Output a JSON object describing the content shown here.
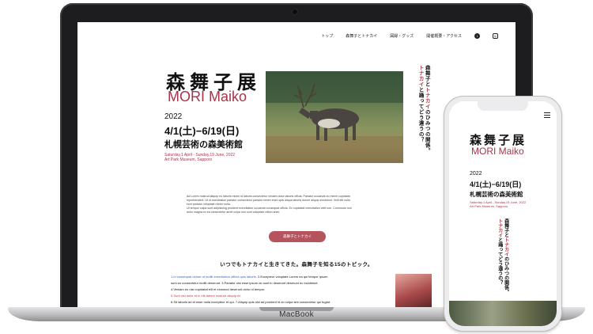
{
  "laptop": {
    "brand": "MacBook",
    "nav": {
      "items": [
        "トップ",
        "森舞子とトナカイ",
        "図録・グッズ",
        "開催概要・アクセス"
      ],
      "icons": [
        "twitter-icon",
        "instagram-icon"
      ]
    },
    "hero": {
      "title_jp": "森舞子展",
      "title_en": "MORI Maiko",
      "year": "2022",
      "dates": "4/1(土)−6/19(日)",
      "venue": "札幌芸術の森美術館",
      "en_dates": "Saturday,1 April - Sunday,19 June, 2022",
      "en_venue": "Art Park Museum, Sapporo",
      "vertical_lines": [
        {
          "parts": [
            {
              "text": "森舞子と",
              "accent": false
            },
            {
              "text": "トナカイ",
              "accent": true
            },
            {
              "text": "のひみつの関係。",
              "accent": false
            }
          ]
        },
        {
          "parts": [
            {
              "text": "トナカイ",
              "accent": true
            },
            {
              "text": "と踊ってどう違うの？",
              "accent": false
            }
          ]
        }
      ]
    },
    "paragraph": [
      "Ad Lorem nostrud aliquip eu laboris minim id laboris consectetur veniam dolor laboris officia. Pariatur occaecat do minim cupidatat",
      "reprehenderit. Ut id exercitation pariatur consectetur pariatur minim enim quis aliqua laboris dolore aliquip incididunt. Velit elit nulla",
      "sunt pariatur voluptate minim nulla.",
      "Ut tempor culpa sunt adipisicing proident exercitation occaecat consequat officia. Ex cupidatat exercitation velit non. Commodo non",
      "dolor magna ex ea consectetur amet culpa non sunt voluptate cillum anim."
    ],
    "button_label": "森舞子とトナカイ",
    "section_title": "いつでもトナカイと生きてきた。森舞子を知る15のトピック。",
    "topics": [
      {
        "text": "1.In consequat dolore ut mollit exercitation officia quis laboris.",
        "color": "blue"
      },
      {
        "text": "2.Excepteur voluptate Lorem ea qui tempor ipsum",
        "color": "dark"
      },
      {
        "text": "sunt eu consectetur mollit deserunt.",
        "color": "dark"
      },
      {
        "text": "3.Pariatur nisi esse ipsum do sunt in deserunt deserunt eu incididunt.",
        "color": "dark"
      },
      {
        "text": "4.Veniam eu nisi cupidatat elit et eiusmod deserunt dolor ut tempor.",
        "color": "dark"
      },
      {
        "text": "5.Sunt nisi dolor et in elit labore nostrud aliquip ex.",
        "color": "red"
      },
      {
        "text": "6.Sit laboris ad et esse nulla excepteur et qui.",
        "color": "dark"
      },
      {
        "text": "7.Aliquip quis nisi ad proident id do culpa sint consectetur qui fugiat.",
        "color": "dark"
      }
    ]
  },
  "phone": {
    "title_jp": "森舞子展",
    "title_en": "MORI Maiko",
    "year": "2022",
    "dates": "4/1(土)−6/19(日)",
    "venue": "札幌芸術の森美術館",
    "en_dates": "Saturday,1 April - Sunday,19 June, 2022",
    "en_venue": "Art Park Museum, Sapporo",
    "vertical_lines": [
      {
        "parts": [
          {
            "text": "森舞子と",
            "accent": false
          },
          {
            "text": "トナカイ",
            "accent": true
          },
          {
            "text": "のひみつの関係。",
            "accent": false
          }
        ]
      },
      {
        "parts": [
          {
            "text": "トナカイ",
            "accent": true
          },
          {
            "text": "と踊ってどう違うの？",
            "accent": false
          }
        ]
      }
    ]
  },
  "colors": {
    "accent": "#a8344a",
    "button": "#b6545e",
    "frame": "#1d1d1f"
  }
}
